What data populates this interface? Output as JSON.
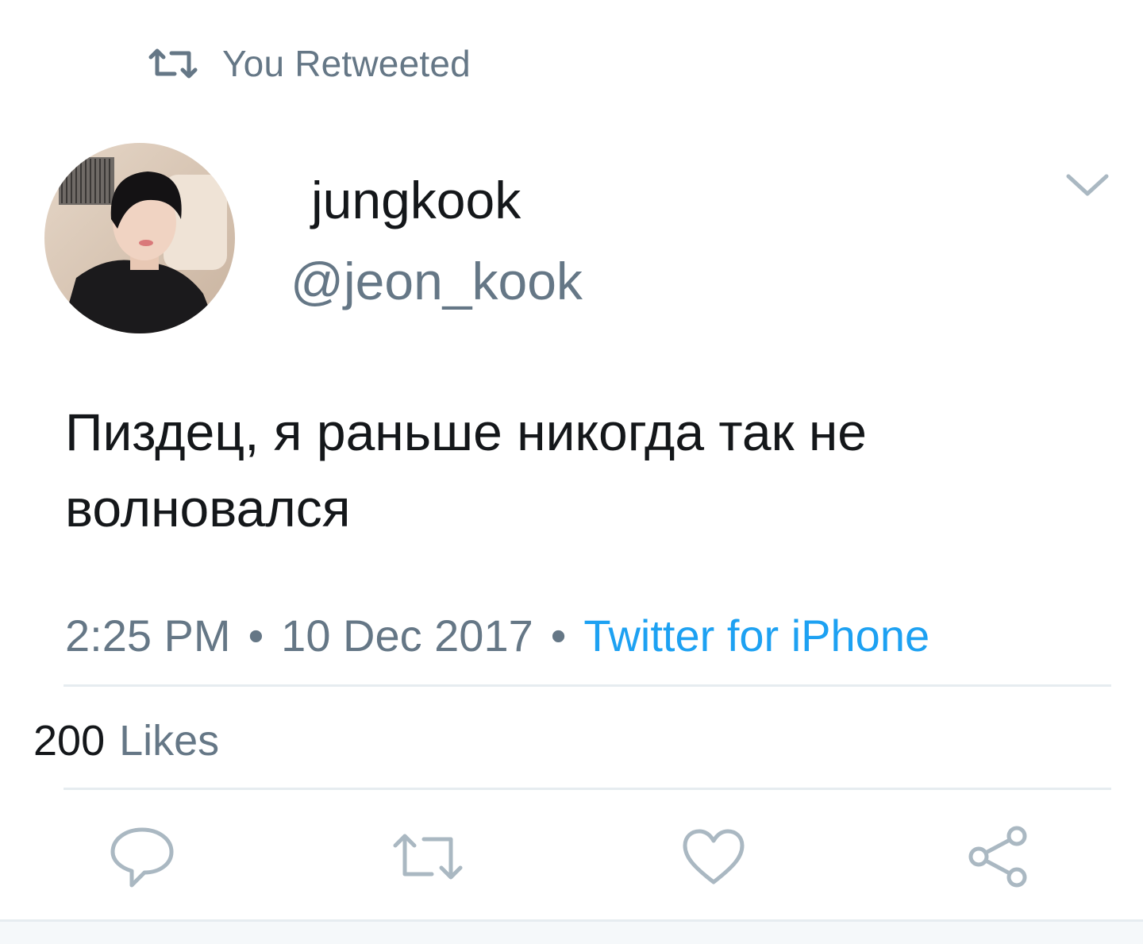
{
  "retweet_context": {
    "icon": "retweet-icon",
    "text": "You Retweeted"
  },
  "author": {
    "display_name": "jungkook",
    "handle": "@jeon_kook",
    "avatar_icon": "avatar-photo"
  },
  "tweet": {
    "text": "Пиздец, я раньше никогда так не волновался",
    "time": "2:25 PM",
    "separator": "•",
    "date": "10 Dec 2017",
    "source": "Twitter for iPhone"
  },
  "stats": {
    "likes_count": "200",
    "likes_label": "Likes"
  },
  "actions": [
    {
      "name": "reply",
      "icon": "reply-icon"
    },
    {
      "name": "retweet",
      "icon": "retweet-icon"
    },
    {
      "name": "like",
      "icon": "heart-icon"
    },
    {
      "name": "share",
      "icon": "share-icon"
    }
  ],
  "colors": {
    "primary_text": "#14171a",
    "secondary_text": "#657786",
    "link": "#1da1f2",
    "divider": "#e6ecf0",
    "icon_gray": "#8899a6"
  }
}
